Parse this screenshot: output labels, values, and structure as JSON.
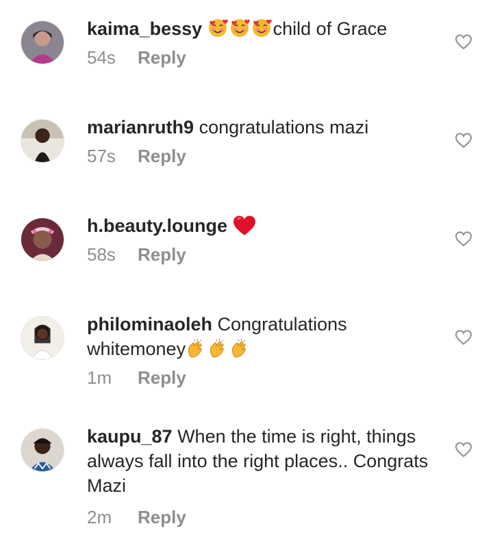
{
  "comments": [
    {
      "username": "kaima_bessy",
      "emojis": [
        "smiling-face-with-hearts",
        "smiling-face-with-hearts",
        "smiling-face-with-hearts"
      ],
      "text": "child of Grace",
      "time": "54s",
      "reply_label": "Reply"
    },
    {
      "username": "marianruth9",
      "emojis": [],
      "text": "congratulations mazi",
      "time": "57s",
      "reply_label": "Reply"
    },
    {
      "username": "h.beauty.lounge",
      "emojis": [
        "red-heart"
      ],
      "text": "",
      "time": "58s",
      "reply_label": "Reply"
    },
    {
      "username": "philominaoleh",
      "emojis": [
        "clapping-hands",
        "clapping-hands",
        "clapping-hands"
      ],
      "text": "Congratulations whitemoney",
      "time": "1m",
      "reply_label": "Reply"
    },
    {
      "username": "kaupu_87",
      "emojis": [],
      "text": "When the time is right, things always fall into the right places.. Congrats Mazi",
      "time": "2m",
      "reply_label": "Reply"
    }
  ],
  "icons": {
    "like": "heart-outline-icon"
  },
  "colors": {
    "text": "#262626",
    "secondary": "#8e8e8e",
    "heart_outline": "#8e8e8e",
    "background": "#ffffff"
  }
}
